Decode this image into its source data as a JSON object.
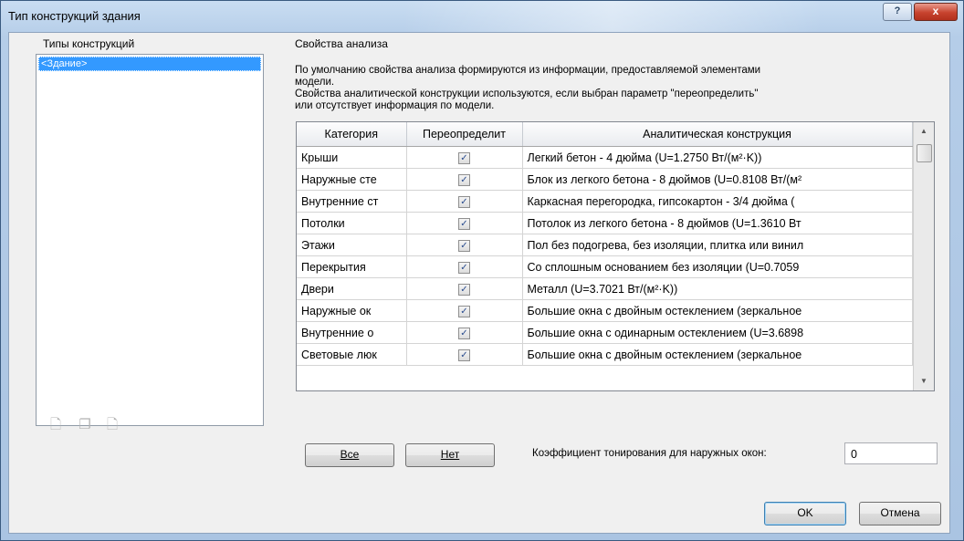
{
  "window": {
    "title": "Тип конструкций здания",
    "help_label": "?",
    "close_label": "x"
  },
  "left_panel": {
    "label": "Типы конструкций",
    "items": [
      {
        "label": "<Здание>"
      }
    ],
    "toolbar_icons": [
      "new-construction-icon",
      "duplicate-construction-icon",
      "delete-construction-icon"
    ]
  },
  "analysis": {
    "label": "Свойства анализа",
    "description_lines": [
      "По умолчанию свойства анализа формируются из информации, предоставляемой элементами",
      "модели.",
      "Свойства аналитической конструкции используются, если выбран параметр \"переопределить\"",
      "или отсутствует информация по модели."
    ]
  },
  "grid": {
    "columns": [
      "Категория",
      "Переопределит",
      "Аналитическая конструкция"
    ],
    "rows": [
      {
        "category": "Крыши",
        "override": true,
        "construction": "Легкий бетон - 4 дюйма (U=1.2750 Вт/(м²·K))"
      },
      {
        "category": "Наружные сте",
        "override": true,
        "construction": "Блок из легкого бетона - 8 дюймов (U=0.8108 Вт/(м²"
      },
      {
        "category": "Внутренние ст",
        "override": true,
        "construction": "Каркасная перегородка, гипсокартон - 3/4 дюйма ("
      },
      {
        "category": "Потолки",
        "override": true,
        "construction": "Потолок из легкого бетона - 8 дюймов (U=1.3610 Вт"
      },
      {
        "category": "Этажи",
        "override": true,
        "construction": "Пол без подогрева, без изоляции, плитка или винил"
      },
      {
        "category": "Перекрытия",
        "override": true,
        "construction": "Со сплошным основанием без изоляции (U=0.7059"
      },
      {
        "category": "Двери",
        "override": true,
        "construction": "Металл (U=3.7021 Вт/(м²·K))"
      },
      {
        "category": "Наружные ок",
        "override": true,
        "construction": "Большие окна с двойным остеклением (зеркальное"
      },
      {
        "category": "Внутренние о",
        "override": true,
        "construction": "Большие окна с одинарным остеклением (U=3.6898"
      },
      {
        "category": "Световые люк",
        "override": true,
        "construction": "Большие окна с двойным остеклением (зеркальное"
      }
    ],
    "check_mark": "✓"
  },
  "buttons": {
    "all_label": "Все",
    "none_label": "Нет",
    "ok_label": "OK",
    "cancel_label": "Отмена"
  },
  "shading": {
    "label": "Коэффициент тонирования для наружных окон:",
    "value": "0"
  }
}
